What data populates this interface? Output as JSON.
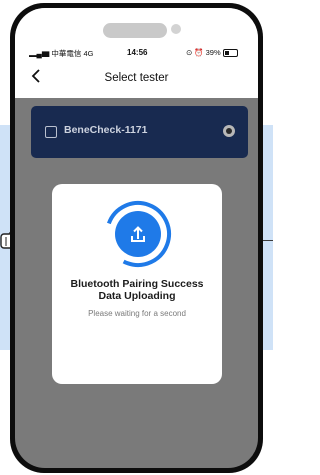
{
  "status_bar": {
    "carrier": "中華電信",
    "network": "4G",
    "time": "14:56",
    "battery": "39%"
  },
  "header": {
    "back_icon": "chevron-left-icon",
    "title": "Select tester"
  },
  "device_list": [
    {
      "name": "BeneCheck-1171",
      "checked": false,
      "selected": true
    }
  ],
  "modal": {
    "icon": "upload-icon",
    "title_line1": "Bluetooth Pairing Success",
    "title_line2": "Data Uploading",
    "subtitle": "Please waiting for a second"
  },
  "colors": {
    "accent": "#1f7ae8",
    "card": "#182a50",
    "overlay": "#7a7a7a",
    "band": "#cfe2f7"
  }
}
